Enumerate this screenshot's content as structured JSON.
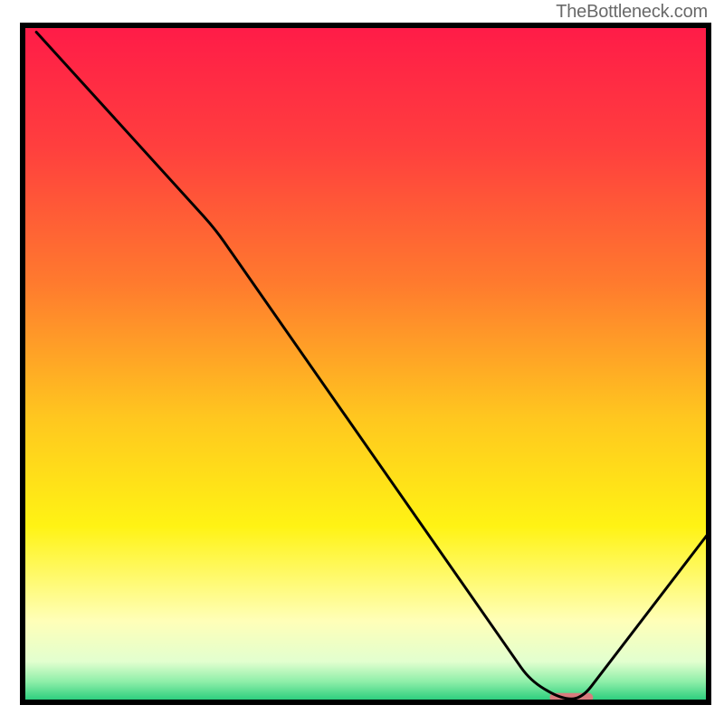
{
  "attribution": "TheBottleneck.com",
  "chart_data": {
    "type": "line",
    "title": "",
    "xlabel": "",
    "ylabel": "",
    "xlim": [
      0,
      100
    ],
    "ylim": [
      0,
      100
    ],
    "curve": {
      "name": "bottleneck-curve",
      "x": [
        2,
        28,
        74,
        78.5,
        81.5,
        100
      ],
      "y": [
        99,
        70,
        3.2,
        0.5,
        0.5,
        25
      ]
    },
    "marker": {
      "name": "sweet-spot",
      "x_start": 77.5,
      "x_end": 82.5,
      "y": 0.7,
      "color": "#d87b7d",
      "thickness": 10
    },
    "background": {
      "type": "vertical-gradient",
      "stops": [
        {
          "pct": 0,
          "color": "#ff1b48"
        },
        {
          "pct": 18,
          "color": "#ff3f3e"
        },
        {
          "pct": 38,
          "color": "#ff7a2e"
        },
        {
          "pct": 58,
          "color": "#ffc71f"
        },
        {
          "pct": 74,
          "color": "#fff314"
        },
        {
          "pct": 88,
          "color": "#ffffb8"
        },
        {
          "pct": 94,
          "color": "#e2ffcf"
        },
        {
          "pct": 97,
          "color": "#8deea8"
        },
        {
          "pct": 100,
          "color": "#1fca78"
        }
      ]
    }
  }
}
